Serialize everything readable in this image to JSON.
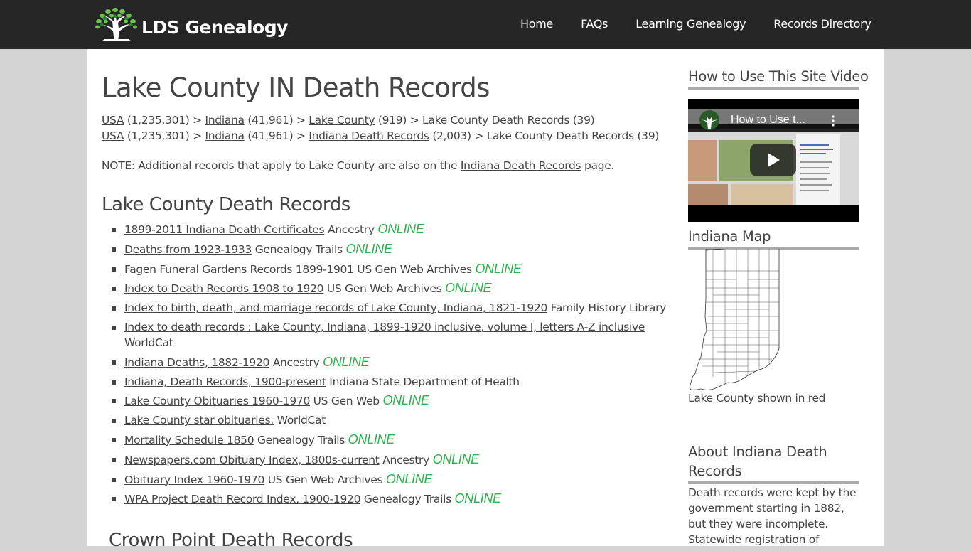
{
  "header": {
    "logo_text": "LDS Genealogy",
    "nav": [
      {
        "label": "Home"
      },
      {
        "label": "FAQs"
      },
      {
        "label": "Learning Genealogy"
      },
      {
        "label": "Records Directory"
      }
    ]
  },
  "main": {
    "title": "Lake County IN Death Records",
    "breadcrumbs": [
      [
        {
          "label": "USA",
          "link": true,
          "count": "(1,235,301)"
        },
        {
          "label": "Indiana",
          "link": true,
          "count": "(41,961)"
        },
        {
          "label": "Lake County",
          "link": true,
          "count": "(919)"
        },
        {
          "label": "Lake County Death Records",
          "link": false,
          "count": "(39)"
        }
      ],
      [
        {
          "label": "USA",
          "link": true,
          "count": "(1,235,301)"
        },
        {
          "label": "Indiana",
          "link": true,
          "count": "(41,961)"
        },
        {
          "label": "Indiana Death Records",
          "link": true,
          "count": "(2,003)"
        },
        {
          "label": "Lake County Death Records",
          "link": false,
          "count": "(39)"
        }
      ]
    ],
    "separator": ">",
    "note": {
      "prefix": "NOTE: Additional records that apply to Lake County are also on the",
      "link": "Indiana Death Records",
      "suffix": "page."
    },
    "section_title": "Lake County Death Records",
    "online_label": "ONLINE",
    "records": [
      {
        "title": "1899-2011 Indiana Death Certificates",
        "source": "Ancestry",
        "online": true
      },
      {
        "title": "Deaths from 1923-1933",
        "source": "Genealogy Trails",
        "online": true
      },
      {
        "title": "Fagen Funeral Gardens Records 1899-1901",
        "source": "US Gen Web Archives",
        "online": true
      },
      {
        "title": "Index to Death Records 1908 to 1920",
        "source": "US Gen Web Archives",
        "online": true
      },
      {
        "title": "Index to birth, death, and marriage records of Lake County, Indiana, 1821-1920",
        "source": "Family History Library",
        "online": false
      },
      {
        "title": "Index to death records : Lake County, Indiana, 1899-1920 inclusive, volume I, letters A-Z inclusive",
        "source": "WorldCat",
        "online": false
      },
      {
        "title": "Indiana Deaths, 1882-1920",
        "source": "Ancestry",
        "online": true
      },
      {
        "title": "Indiana, Death Records, 1900-present",
        "source": "Indiana State Department of Health",
        "online": false
      },
      {
        "title": "Lake County Obituaries 1960-1970",
        "source": "US Gen Web",
        "online": true
      },
      {
        "title": "Lake County star obituaries.",
        "source": "WorldCat",
        "online": false
      },
      {
        "title": "Mortality Schedule 1850",
        "source": "Genealogy Trails",
        "online": true
      },
      {
        "title": "Newspapers.com Obituary Index, 1800s-current",
        "source": "Ancestry",
        "online": true
      },
      {
        "title": "Obituary Index 1960-1970",
        "source": "US Gen Web Archives",
        "online": true
      },
      {
        "title": "WPA Project Death Record Index, 1900-1920",
        "source": "Genealogy Trails",
        "online": true
      }
    ],
    "next_section_title": "Crown Point Death Records"
  },
  "sidebar": {
    "video_heading": "How to Use This Site Video",
    "video_title": "How to Use t...",
    "map_heading": "Indiana Map",
    "map_caption": "Lake County shown in red",
    "about_heading": "About Indiana Death Records",
    "about_text": "Death records were kept by the government starting in 1882, but they were incomplete. Statewide registration of"
  },
  "colors": {
    "header_bg": "#262626",
    "online_green": "#2bb24c",
    "highlight_county": "#ff0000",
    "lake_michigan": "#9999ee"
  }
}
